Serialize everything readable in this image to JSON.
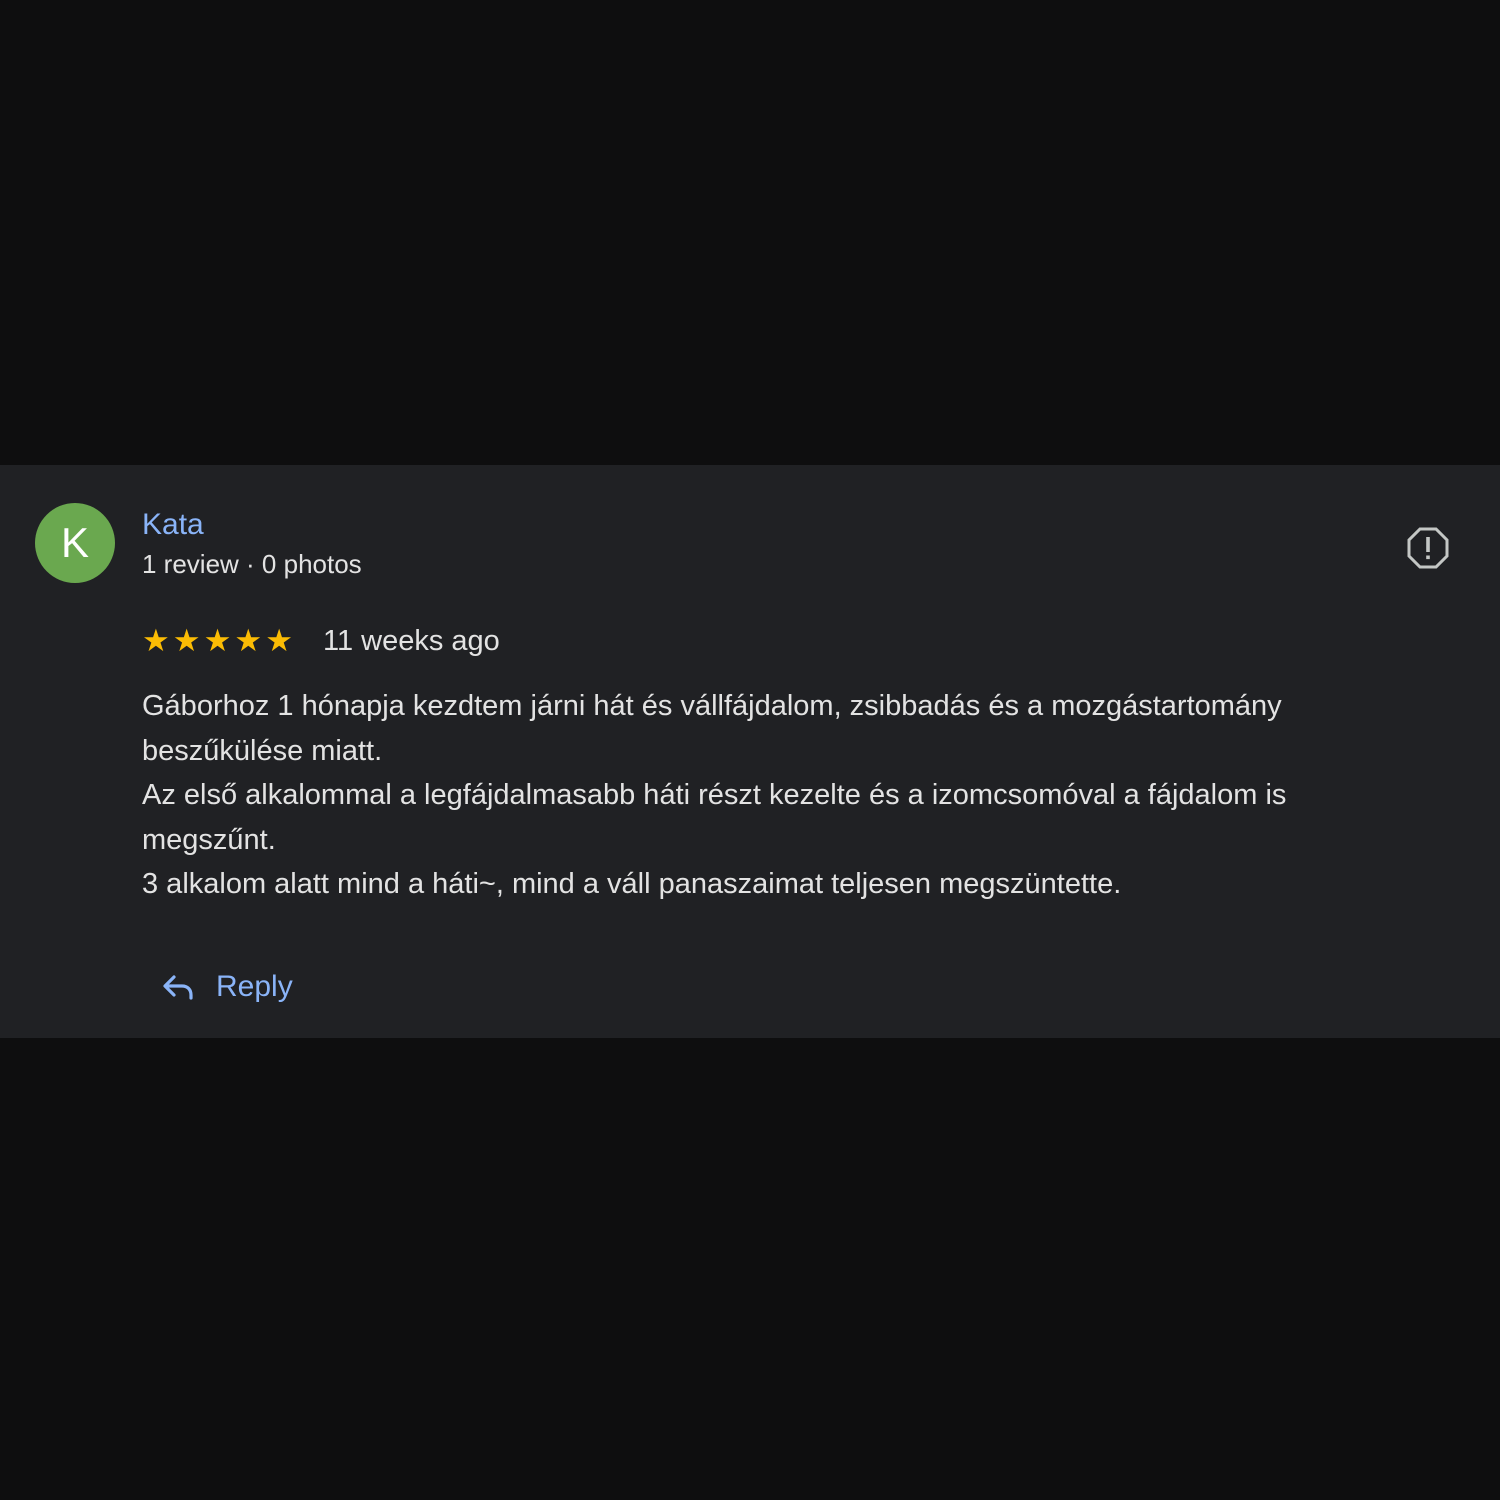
{
  "review": {
    "author": {
      "initial": "K",
      "name": "Kata",
      "meta": "1 review · 0 photos",
      "avatar_color": "#6aa84f"
    },
    "rating": {
      "stars": 5,
      "max_stars": 5,
      "star_glyph": "★",
      "star_color": "#fbbc04"
    },
    "time_ago": "11 weeks ago",
    "text_lines": [
      "Gáborhoz 1 hónapja kezdtem járni hát és vállfájdalom, zsibbadás és a mozgástartomány",
      "beszűkülése miatt.",
      "Az első alkalommal a legfájdalmasabb háti részt kezelte és a izomcsomóval a fájdalom is",
      "megszűnt.",
      "3 alkalom alatt mind a háti~, mind a váll panaszaimat teljesen megszüntette."
    ],
    "report_icon": "report-flag-icon",
    "reply_icon": "reply-arrow-icon",
    "reply_label": "Reply"
  },
  "colors": {
    "page_background": "#0e0e0f",
    "card_background": "#202124",
    "link_blue": "#8ab4f8",
    "text_primary": "#e3e3e3",
    "icon_gray": "#c4c7c5"
  }
}
